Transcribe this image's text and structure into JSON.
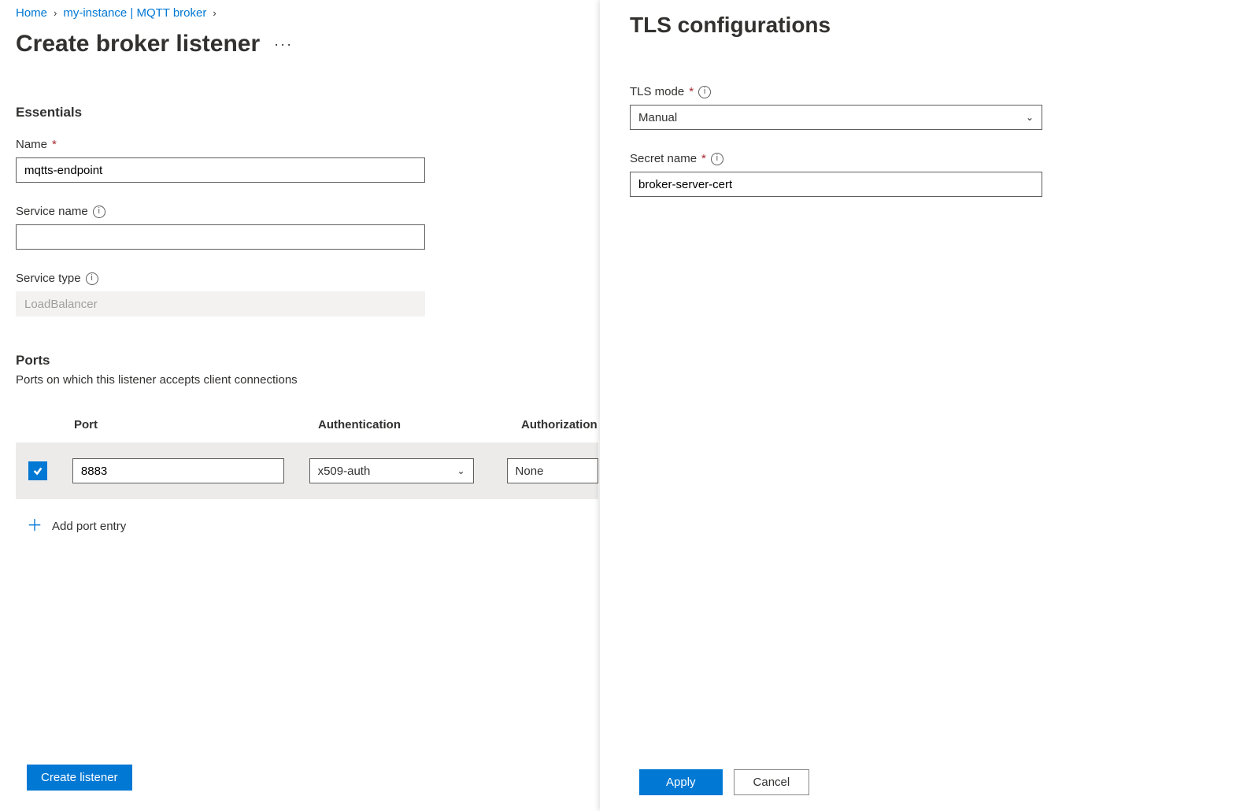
{
  "breadcrumb": {
    "home": "Home",
    "instance": "my-instance | MQTT broker"
  },
  "page": {
    "title": "Create broker listener"
  },
  "essentials": {
    "heading": "Essentials",
    "name_label": "Name",
    "name_value": "mqtts-endpoint",
    "service_name_label": "Service name",
    "service_name_value": "",
    "service_type_label": "Service type",
    "service_type_value": "LoadBalancer"
  },
  "ports": {
    "heading": "Ports",
    "description": "Ports on which this listener accepts client connections",
    "columns": {
      "port": "Port",
      "auth": "Authentication",
      "azn": "Authorization"
    },
    "rows": [
      {
        "checked": true,
        "port": "8883",
        "auth": "x509-auth",
        "azn": "None"
      }
    ],
    "add_label": "Add port entry"
  },
  "footer": {
    "create": "Create listener"
  },
  "panel": {
    "title": "TLS configurations",
    "tls_mode_label": "TLS mode",
    "tls_mode_value": "Manual",
    "secret_name_label": "Secret name",
    "secret_name_value": "broker-server-cert",
    "apply": "Apply",
    "cancel": "Cancel"
  }
}
